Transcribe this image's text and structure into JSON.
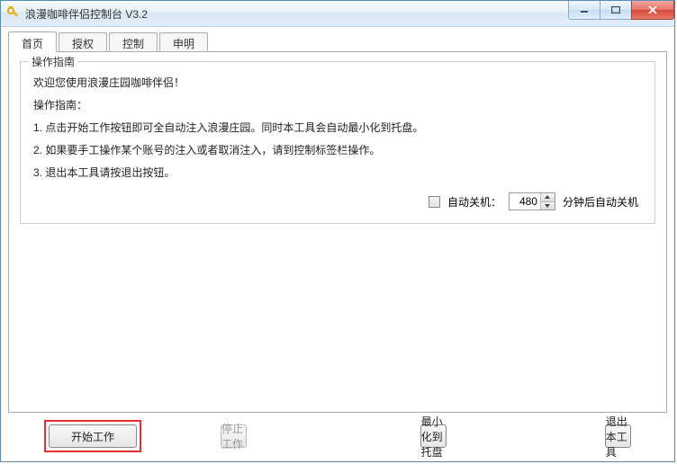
{
  "window": {
    "title": "浪漫咖啡伴侣控制台 V3.2"
  },
  "tabs": [
    {
      "label": "首页"
    },
    {
      "label": "授权"
    },
    {
      "label": "控制"
    },
    {
      "label": "申明"
    }
  ],
  "guide": {
    "legend": "操作指南",
    "welcome": "欢迎您使用浪漫庄园咖啡伴侣！",
    "heading": "操作指南：",
    "step1": "1. 点击开始工作按钮即可全自动注入浪漫庄园。同时本工具会自动最小化到托盘。",
    "step2": "2. 如果要手工操作某个账号的注入或者取消注入，请到控制标签栏操作。",
    "step3": "3. 退出本工具请按退出按钮。"
  },
  "shutdown": {
    "checkbox_label": "自动关机：",
    "minutes": "480",
    "suffix": "分钟后自动关机"
  },
  "buttons": {
    "start": "开始工作",
    "stop": "停止工作",
    "minimize_tray": "最小化到托盘",
    "exit": "退出本工具"
  }
}
